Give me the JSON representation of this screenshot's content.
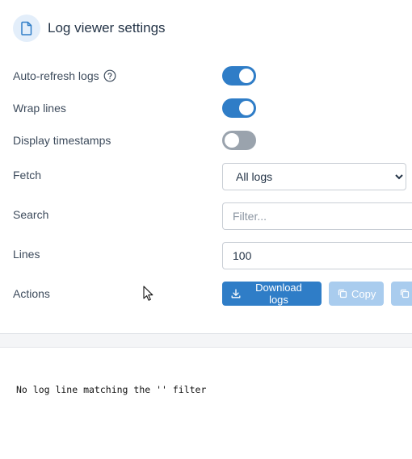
{
  "header": {
    "title": "Log viewer settings",
    "icon": "document-icon"
  },
  "colors": {
    "accent": "#2f7dc7",
    "accent_disabled": "#a9ccee",
    "toggle_off": "#9aa3ad",
    "text": "#3d4b5c"
  },
  "settings": {
    "auto_refresh": {
      "label": "Auto-refresh logs",
      "enabled": true,
      "help_icon": "question-circle-icon"
    },
    "wrap_lines": {
      "label": "Wrap lines",
      "enabled": true
    },
    "display_timestamps": {
      "label": "Display timestamps",
      "enabled": false
    },
    "fetch": {
      "label": "Fetch",
      "selected": "All logs"
    },
    "search": {
      "label": "Search",
      "value": "",
      "placeholder": "Filter..."
    },
    "lines": {
      "label": "Lines",
      "value": "100"
    },
    "actions": {
      "label": "Actions",
      "download_label": "Download logs",
      "download_icon": "download-icon",
      "copy_label": "Copy",
      "copy_icon": "copy-icon",
      "extra_icon": "copy-icon"
    }
  },
  "log": {
    "message": "No log line matching the '' filter"
  }
}
